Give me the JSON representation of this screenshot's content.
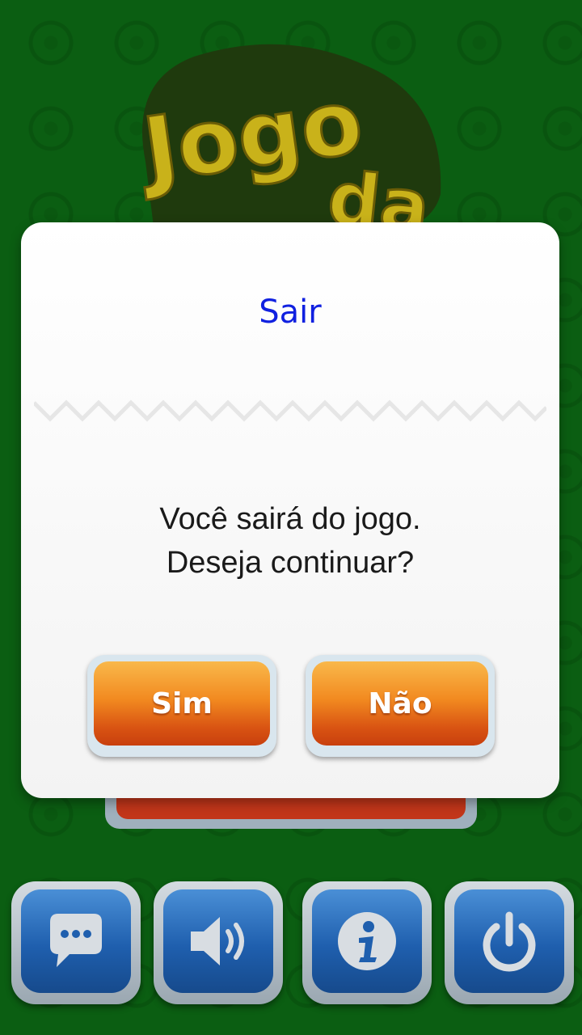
{
  "logo": {
    "text_line1": "Jogo",
    "text_line2": "da"
  },
  "dialog": {
    "title": "Sair",
    "message_line1": "Você sairá do jogo.",
    "message_line2": "Deseja continuar?",
    "yes_label": "Sim",
    "no_label": "Não"
  },
  "bottom_bar": {
    "icons": [
      "chat-icon",
      "sound-icon",
      "info-icon",
      "power-icon"
    ]
  },
  "colors": {
    "background": "#0b5e12",
    "title": "#1020e0",
    "button_orange": "#f28a20",
    "icon_blue": "#1f5fae"
  }
}
